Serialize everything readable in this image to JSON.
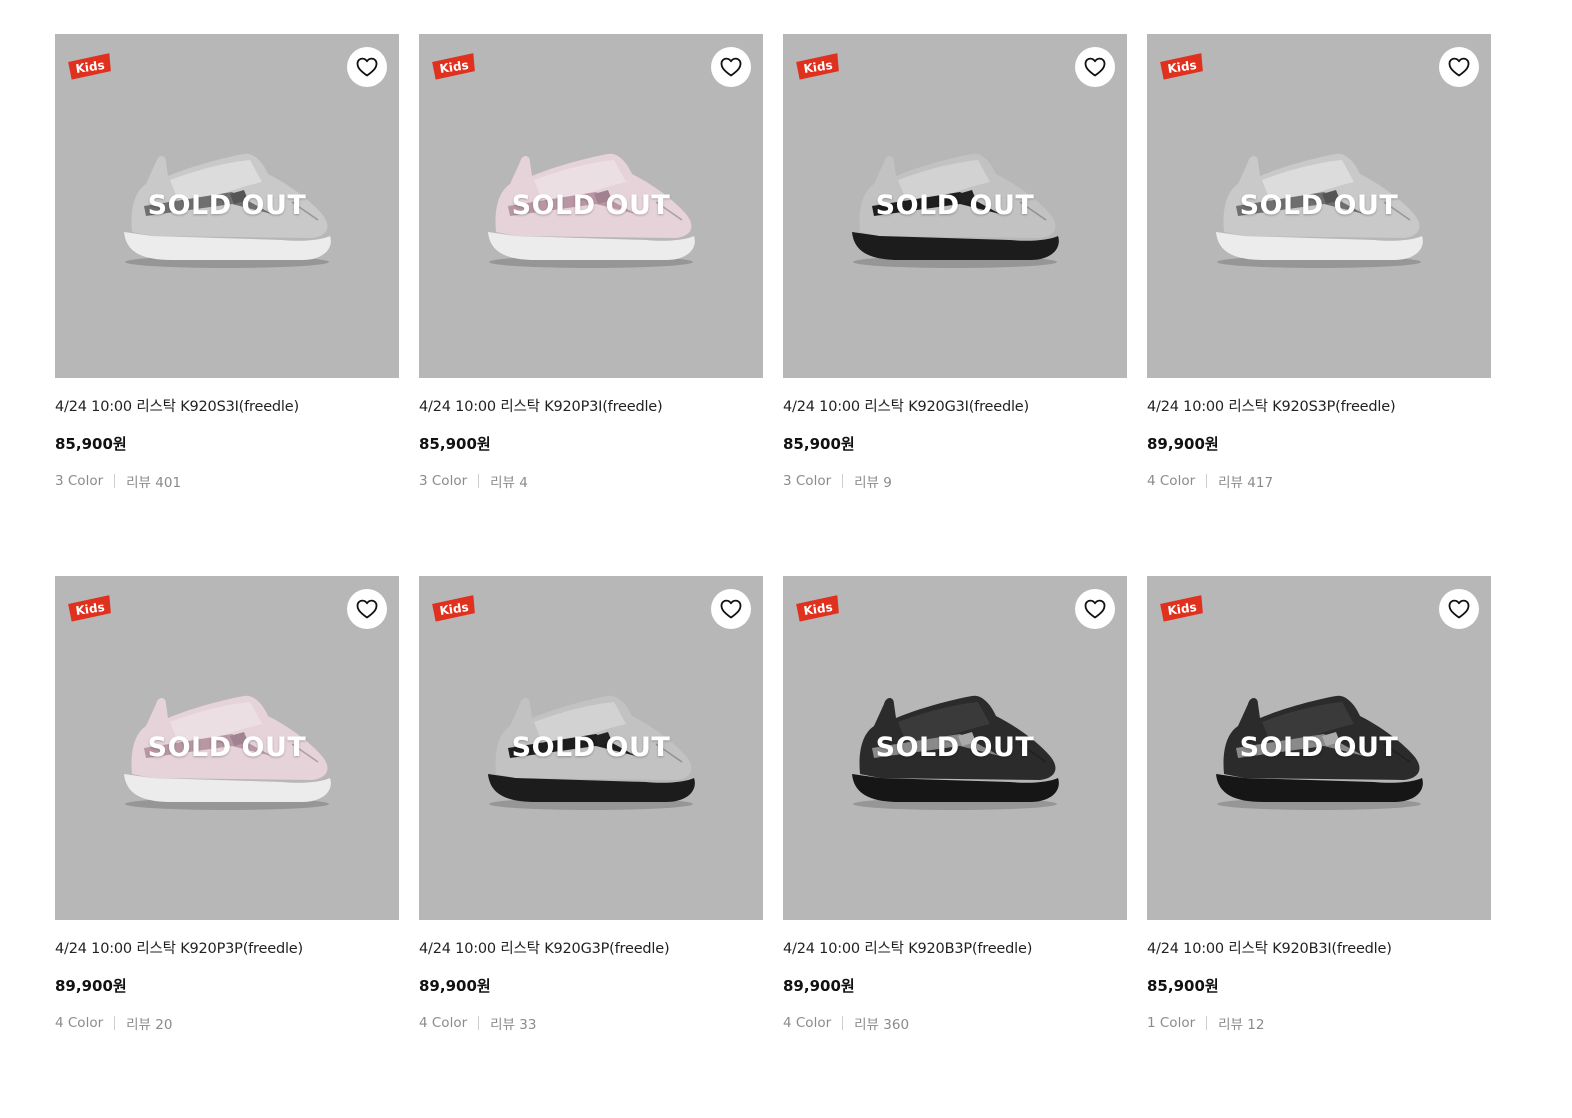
{
  "sold_out_label": "SOLD OUT",
  "kids_badge_text": "Kids",
  "colors": {
    "thumb_bg": "#b7b7b7",
    "badge_red": "#e0301e"
  },
  "products": [
    {
      "title": "4/24 10:00 리스탁 K920S3I(freedle)",
      "price": "85,900원",
      "colors": "3 Color",
      "reviews": "리뷰 401",
      "variant": "silver"
    },
    {
      "title": "4/24 10:00 리스탁 K920P3I(freedle)",
      "price": "85,900원",
      "colors": "3 Color",
      "reviews": "리뷰 4",
      "variant": "pink"
    },
    {
      "title": "4/24 10:00 리스탁 K920G3I(freedle)",
      "price": "85,900원",
      "colors": "3 Color",
      "reviews": "리뷰 9",
      "variant": "grey-black"
    },
    {
      "title": "4/24 10:00 리스탁 K920S3P(freedle)",
      "price": "89,900원",
      "colors": "4 Color",
      "reviews": "리뷰 417",
      "variant": "silver"
    },
    {
      "title": "4/24 10:00 리스탁 K920P3P(freedle)",
      "price": "89,900원",
      "colors": "4 Color",
      "reviews": "리뷰 20",
      "variant": "pink"
    },
    {
      "title": "4/24 10:00 리스탁 K920G3P(freedle)",
      "price": "89,900원",
      "colors": "4 Color",
      "reviews": "리뷰 33",
      "variant": "grey-black"
    },
    {
      "title": "4/24 10:00 리스탁 K920B3P(freedle)",
      "price": "89,900원",
      "colors": "4 Color",
      "reviews": "리뷰 360",
      "variant": "black"
    },
    {
      "title": "4/24 10:00 리스탁 K920B3I(freedle)",
      "price": "85,900원",
      "colors": "1 Color",
      "reviews": "리뷰 12",
      "variant": "black"
    }
  ]
}
